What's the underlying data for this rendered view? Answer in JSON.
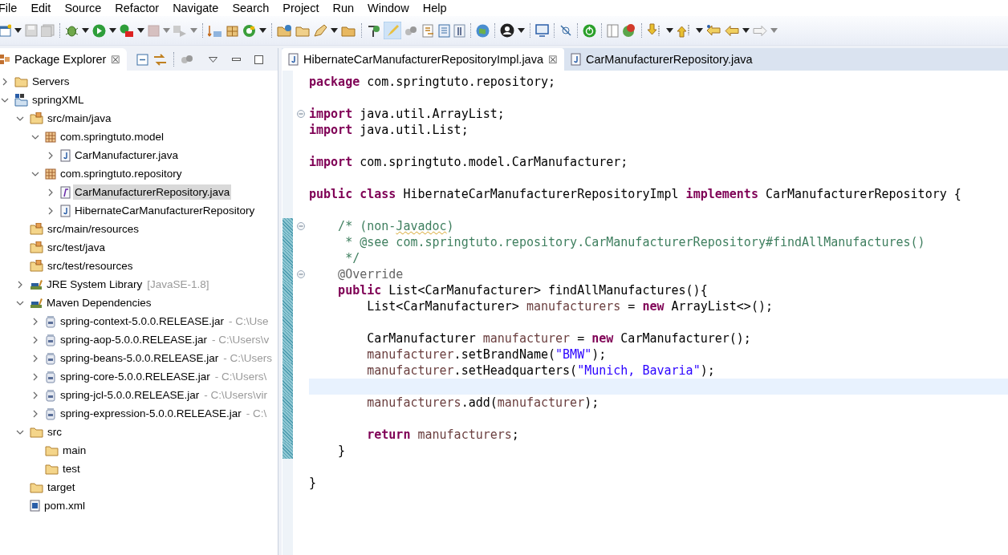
{
  "menu": [
    "File",
    "Edit",
    "Source",
    "Refactor",
    "Navigate",
    "Search",
    "Project",
    "Run",
    "Window",
    "Help"
  ],
  "explorer": {
    "title": "Package Explorer",
    "close": "☒",
    "tree": [
      {
        "label": "Servers",
        "kind": "folder",
        "expanded": false,
        "selected": false
      },
      {
        "label": "springXML",
        "kind": "project",
        "expanded": true,
        "selected": false,
        "children": [
          {
            "label": "src/main/java",
            "kind": "srcfolder",
            "expanded": true,
            "selected": false,
            "children": [
              {
                "label": "com.springtuto.model",
                "kind": "package",
                "expanded": true,
                "selected": false,
                "children": [
                  {
                    "label": "CarManufacturer.java",
                    "kind": "java",
                    "expanded": false,
                    "selected": false
                  }
                ]
              },
              {
                "label": "com.springtuto.repository",
                "kind": "package",
                "expanded": true,
                "selected": false,
                "children": [
                  {
                    "label": "CarManufacturerRepository.java",
                    "kind": "interface",
                    "expanded": false,
                    "selected": true
                  },
                  {
                    "label": "HibernateCarManufacturerRepository",
                    "kind": "java",
                    "expanded": false,
                    "selected": false
                  }
                ]
              }
            ]
          },
          {
            "label": "src/main/resources",
            "kind": "srcfolder",
            "selected": false
          },
          {
            "label": "src/test/java",
            "kind": "srcfolder",
            "selected": false
          },
          {
            "label": "src/test/resources",
            "kind": "srcfolder",
            "selected": false
          },
          {
            "label": "JRE System Library",
            "decoration": "[JavaSE-1.8]",
            "kind": "library",
            "expanded": false,
            "selected": false
          },
          {
            "label": "Maven Dependencies",
            "kind": "library",
            "expanded": true,
            "selected": false,
            "children": [
              {
                "label": "spring-context-5.0.0.RELEASE.jar",
                "decoration": "- C:\\Use",
                "kind": "jar",
                "expanded": false,
                "selected": false
              },
              {
                "label": "spring-aop-5.0.0.RELEASE.jar",
                "decoration": "- C:\\Users\\v",
                "kind": "jar",
                "expanded": false,
                "selected": false
              },
              {
                "label": "spring-beans-5.0.0.RELEASE.jar",
                "decoration": "- C:\\Users",
                "kind": "jar",
                "expanded": false,
                "selected": false
              },
              {
                "label": "spring-core-5.0.0.RELEASE.jar",
                "decoration": "- C:\\Users\\",
                "kind": "jar",
                "expanded": false,
                "selected": false
              },
              {
                "label": "spring-jcl-5.0.0.RELEASE.jar",
                "decoration": "- C:\\Users\\vir",
                "kind": "jar",
                "expanded": false,
                "selected": false
              },
              {
                "label": "spring-expression-5.0.0.RELEASE.jar",
                "decoration": "- C:\\",
                "kind": "jar",
                "expanded": false,
                "selected": false
              }
            ]
          },
          {
            "label": "src",
            "kind": "folder",
            "expanded": true,
            "selected": false,
            "children": [
              {
                "label": "main",
                "kind": "folder",
                "selected": false
              },
              {
                "label": "test",
                "kind": "folder",
                "selected": false
              }
            ]
          },
          {
            "label": "target",
            "kind": "folder",
            "selected": false
          },
          {
            "label": "pom.xml",
            "kind": "xml",
            "selected": false
          }
        ]
      }
    ]
  },
  "editor": {
    "tabs": [
      {
        "label": "HibernateCarManufacturerRepositoryImpl.java",
        "close": "☒",
        "selected": true
      },
      {
        "label": "CarManufacturerRepository.java",
        "selected": false
      }
    ],
    "lines": [
      {
        "current": false,
        "range": false,
        "tokens": [
          {
            "kind": "kw",
            "text": "package"
          },
          {
            "kind": "plain",
            "text": " com.springtuto.repository;"
          }
        ]
      },
      {
        "current": false,
        "range": false
      },
      {
        "current": false,
        "range": false,
        "fold": true,
        "tokens": [
          {
            "kind": "kw",
            "text": "import"
          },
          {
            "kind": "plain",
            "text": " java.util.ArrayList;"
          }
        ]
      },
      {
        "current": false,
        "range": false,
        "tokens": [
          {
            "kind": "kw",
            "text": "import"
          },
          {
            "kind": "plain",
            "text": " java.util.List;"
          }
        ]
      },
      {
        "current": false,
        "range": false
      },
      {
        "current": false,
        "range": false,
        "tokens": [
          {
            "kind": "kw",
            "text": "import"
          },
          {
            "kind": "plain",
            "text": " com.springtuto.model.CarManufacturer;"
          }
        ]
      },
      {
        "current": false,
        "range": false
      },
      {
        "current": false,
        "range": false,
        "tokens": [
          {
            "kind": "kw",
            "text": "public class"
          },
          {
            "kind": "plain",
            "text": " HibernateCarManufacturerRepositoryImpl "
          },
          {
            "kind": "kw",
            "text": "implements"
          },
          {
            "kind": "plain",
            "text": " CarManufacturerRepository {"
          }
        ]
      },
      {
        "current": false,
        "range": false
      },
      {
        "current": false,
        "range": true,
        "fold": true,
        "tokens": [
          {
            "kind": "comment",
            "text": "    /* (non-"
          },
          {
            "kind": "misspelled",
            "text": "Javadoc"
          },
          {
            "kind": "comment",
            "text": ")"
          }
        ]
      },
      {
        "current": false,
        "range": true,
        "tokens": [
          {
            "kind": "comment",
            "text": "     * @see com.springtuto.repository.CarManufacturerRepository#findAllManufactures()"
          }
        ]
      },
      {
        "current": false,
        "range": true,
        "tokens": [
          {
            "kind": "comment",
            "text": "     */"
          }
        ]
      },
      {
        "current": false,
        "range": true,
        "fold": true,
        "tokens": [
          {
            "kind": "annotation",
            "text": "    @Override"
          }
        ]
      },
      {
        "current": false,
        "range": true,
        "tokens": [
          {
            "kind": "kw",
            "text": "    public"
          },
          {
            "kind": "plain",
            "text": " List<CarManufacturer> findAllManufactures(){"
          }
        ]
      },
      {
        "current": false,
        "range": true,
        "tokens": [
          {
            "kind": "plain",
            "text": "        List<CarManufacturer> "
          },
          {
            "kind": "local",
            "text": "manufacturers"
          },
          {
            "kind": "plain",
            "text": " = "
          },
          {
            "kind": "kw",
            "text": "new"
          },
          {
            "kind": "plain",
            "text": " ArrayList<>();"
          }
        ]
      },
      {
        "current": false,
        "range": true
      },
      {
        "current": false,
        "range": true,
        "tokens": [
          {
            "kind": "plain",
            "text": "        CarManufacturer "
          },
          {
            "kind": "local",
            "text": "manufacturer"
          },
          {
            "kind": "plain",
            "text": " = "
          },
          {
            "kind": "kw",
            "text": "new"
          },
          {
            "kind": "plain",
            "text": " CarManufacturer();"
          }
        ]
      },
      {
        "current": false,
        "range": true,
        "tokens": [
          {
            "kind": "local",
            "text": "        manufacturer"
          },
          {
            "kind": "plain",
            "text": ".setBrandName("
          },
          {
            "kind": "string",
            "text": "\"BMW\""
          },
          {
            "kind": "plain",
            "text": ");"
          }
        ]
      },
      {
        "current": false,
        "range": true,
        "tokens": [
          {
            "kind": "local",
            "text": "        manufacturer"
          },
          {
            "kind": "plain",
            "text": ".setHeadquarters("
          },
          {
            "kind": "string",
            "text": "\"Munich, Bavaria\""
          },
          {
            "kind": "plain",
            "text": ");"
          }
        ]
      },
      {
        "current": true,
        "range": true
      },
      {
        "current": false,
        "range": true,
        "tokens": [
          {
            "kind": "local",
            "text": "        manufacturers"
          },
          {
            "kind": "plain",
            "text": ".add("
          },
          {
            "kind": "local",
            "text": "manufacturer"
          },
          {
            "kind": "plain",
            "text": ");"
          }
        ]
      },
      {
        "current": false,
        "range": true
      },
      {
        "current": false,
        "range": true,
        "tokens": [
          {
            "kind": "kw",
            "text": "        return"
          },
          {
            "kind": "local",
            "text": " manufacturers"
          },
          {
            "kind": "plain",
            "text": ";"
          }
        ]
      },
      {
        "current": false,
        "range": true,
        "tokens": [
          {
            "kind": "plain",
            "text": "    }"
          }
        ]
      },
      {
        "current": false,
        "range": false
      },
      {
        "current": false,
        "range": false,
        "tokens": [
          {
            "kind": "plain",
            "text": "}"
          }
        ]
      }
    ]
  }
}
